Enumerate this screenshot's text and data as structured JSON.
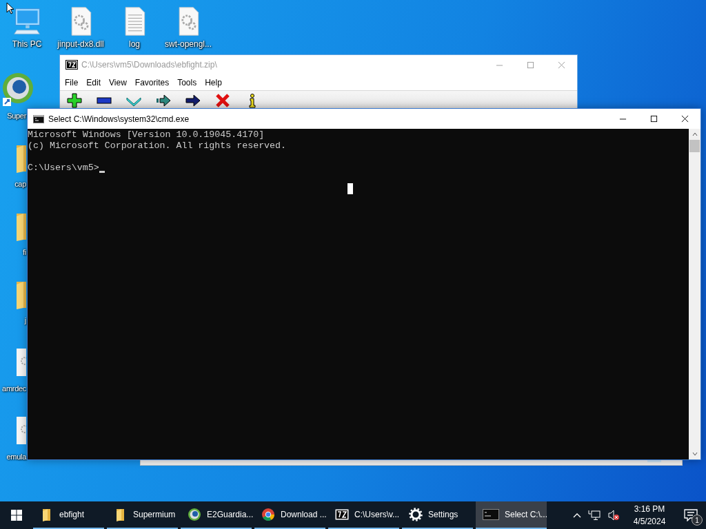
{
  "desktop": {
    "top_icons": [
      {
        "label": "This PC",
        "kind": "pc"
      },
      {
        "label": "jinput-dx8.dll",
        "kind": "gear-file"
      },
      {
        "label": "log",
        "kind": "text-file"
      },
      {
        "label": "swt-opengl...",
        "kind": "gear-file"
      }
    ],
    "left_icons": [
      {
        "label": "Super",
        "kind": "globe"
      },
      {
        "label": "cap",
        "kind": "folder"
      },
      {
        "label": "fi",
        "kind": "folder"
      },
      {
        "label": "j",
        "kind": "folder"
      },
      {
        "label": "amrdec",
        "kind": "gear-file"
      },
      {
        "label": "emula",
        "kind": "gear-file"
      }
    ]
  },
  "archive_window": {
    "title": "C:\\Users\\vm5\\Downloads\\ebfight.zip\\",
    "active": false,
    "menu": [
      "File",
      "Edit",
      "View",
      "Favorites",
      "Tools",
      "Help"
    ],
    "toolbar": [
      {
        "kind": "add"
      },
      {
        "kind": "remove"
      },
      {
        "kind": "test"
      },
      {
        "kind": "copy"
      },
      {
        "kind": "move"
      },
      {
        "kind": "delete"
      },
      {
        "kind": "info"
      }
    ]
  },
  "console_window": {
    "title": "Select C:\\Windows\\system32\\cmd.exe",
    "active": true,
    "lines": [
      "Microsoft Windows [Version 10.0.19045.4170]",
      "(c) Microsoft Corporation. All rights reserved."
    ],
    "prompt": "C:\\Users\\vm5>"
  },
  "taskbar": {
    "items": [
      {
        "label": "ebfight",
        "kind": "folder",
        "selected": false
      },
      {
        "label": "Supermium",
        "kind": "folder",
        "selected": false
      },
      {
        "label": "E2Guardia...",
        "kind": "globe",
        "selected": false
      },
      {
        "label": "Download ...",
        "kind": "chrome",
        "selected": false
      },
      {
        "label": "C:\\Users\\v...",
        "kind": "sevenzip",
        "selected": false
      },
      {
        "label": "Settings",
        "kind": "gear",
        "selected": false
      },
      {
        "label": "Select C:\\...",
        "kind": "console",
        "selected": true
      }
    ],
    "time": "3:16 PM",
    "date": "4/5/2024",
    "notification_count": "1"
  }
}
